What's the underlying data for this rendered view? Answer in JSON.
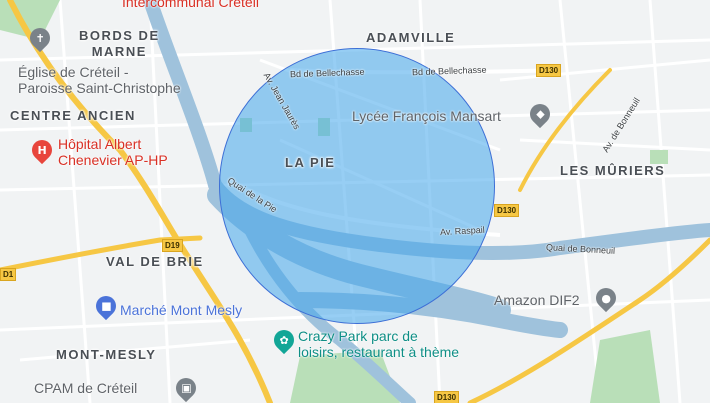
{
  "map": {
    "colors": {
      "background": "#f1f3f4",
      "water": "#9fc2dc",
      "major_road": "#f6c744",
      "park": "#b9dfb8",
      "radius_fill": "#42a6eb",
      "radius_stroke": "#3d6fd6"
    },
    "areas": {
      "bords_de_marne": "BORDS DE\nMARNE",
      "adamville": "ADAMVILLE",
      "centre_ancien": "CENTRE ANCIEN",
      "la_pie": "LA PIE",
      "les_muriers": "LES MÛRIERS",
      "val_de_brie": "VAL DE BRIE",
      "mont_mesly": "MONT-MESLY"
    },
    "places": {
      "hospital_top": "Intercommunal Créteil",
      "church": "Église de Créteil -\nParoisse Saint-Christophe",
      "hospital": "Hôpital Albert\nChenevier AP-HP",
      "lycee": "Lycée François Mansart",
      "amazon": "Amazon DIF2",
      "marche": "Marché Mont Mesly",
      "crazy_park": "Crazy Park parc de\nloisirs, restaurant à thème",
      "cpam": "CPAM de Créteil"
    },
    "streets": {
      "bellechasse_1": "Bd de Bellechasse",
      "bellechasse_2": "Bd de Bellechasse",
      "jean_jaures": "Av. Jean Jaurès",
      "quai_pie": "Quai de la Pie",
      "raspail": "Av. Raspail",
      "bonneuil_av": "Av. de Bonneuil",
      "quai_bonneuil": "Quai de Bonneuil"
    },
    "route_shields": {
      "d130_top": "D130",
      "d130_mid": "D130",
      "d130_bottom": "D130",
      "d19": "D19",
      "d1": "D1"
    },
    "icons": {
      "church_pin": "✝",
      "hospital_pin": "H",
      "lycee_pin": "◆",
      "amazon_pin": "●",
      "marche_pin": "■",
      "park_pin": "✿",
      "cpam_pin": "▣"
    }
  }
}
